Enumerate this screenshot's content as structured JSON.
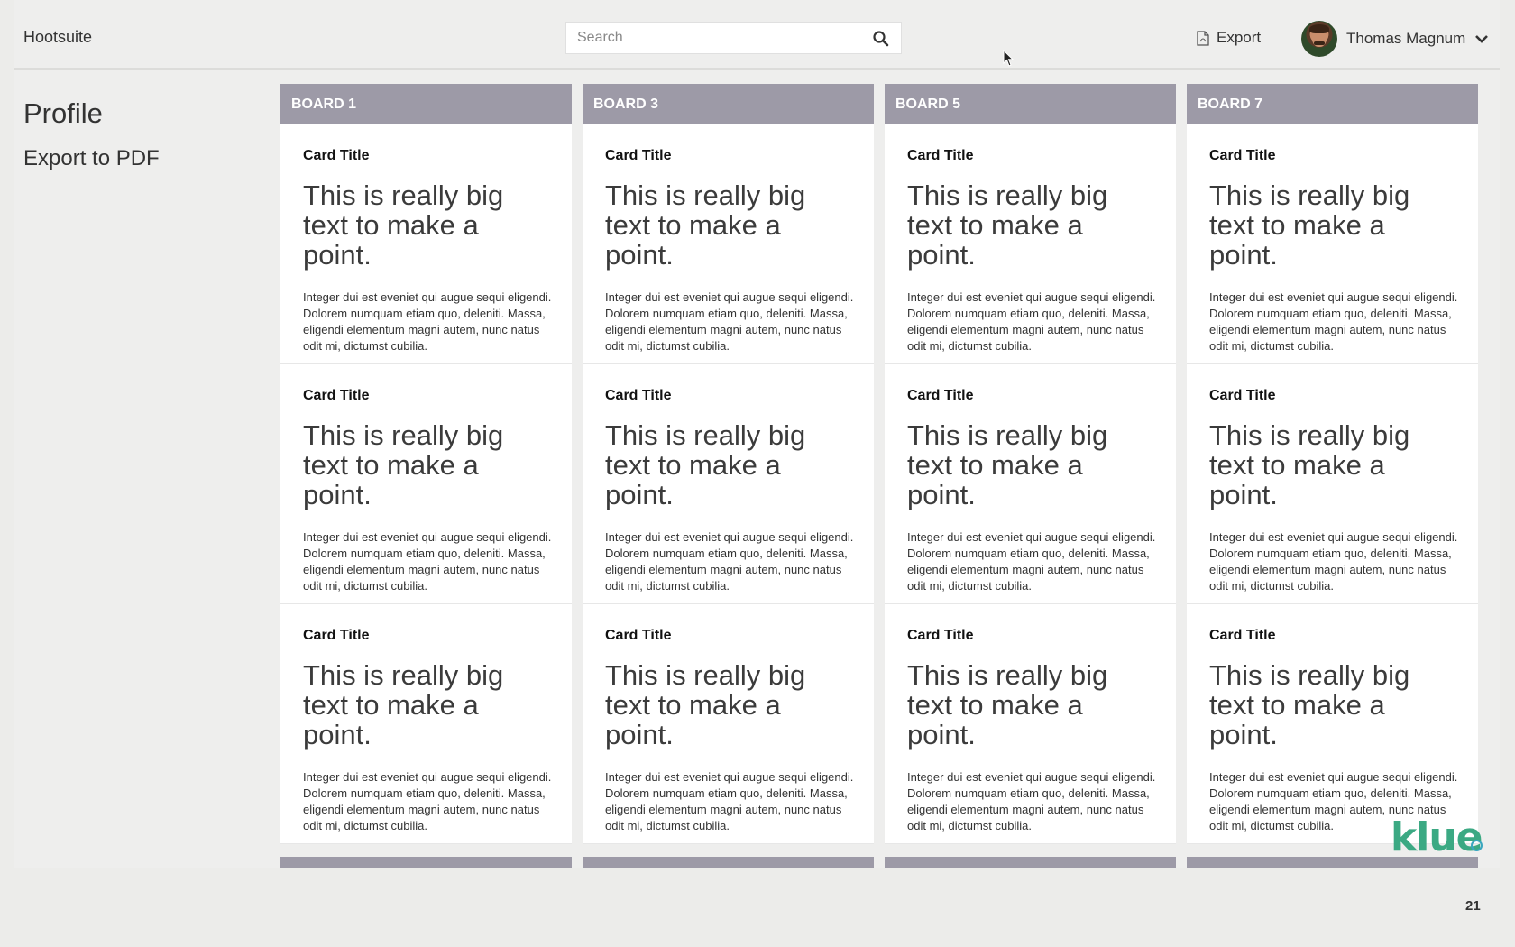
{
  "header": {
    "brand": "Hootsuite",
    "search_placeholder": "Search",
    "export_label": "Export",
    "user_name": "Thomas Magnum"
  },
  "sidebar": {
    "title": "Profile",
    "items": [
      {
        "label": "Export to PDF"
      }
    ]
  },
  "boards": [
    {
      "title": "BOARD 1"
    },
    {
      "title": "BOARD 3"
    },
    {
      "title": "BOARD 5"
    },
    {
      "title": "BOARD 7"
    }
  ],
  "card": {
    "title": "Card Title",
    "big_text": "This is really big text to make a point.",
    "body": "Integer dui est eveniet qui augue sequi eligendi. Dolorem numquam etiam quo, deleniti. Massa, eligendi elementum magni autem, nunc natus odit mi, dictumst cubilia."
  },
  "footer": {
    "logo": "klue",
    "page_number": "21"
  },
  "colors": {
    "board_header": "#9d9aa7",
    "logo": "#3ba983"
  }
}
